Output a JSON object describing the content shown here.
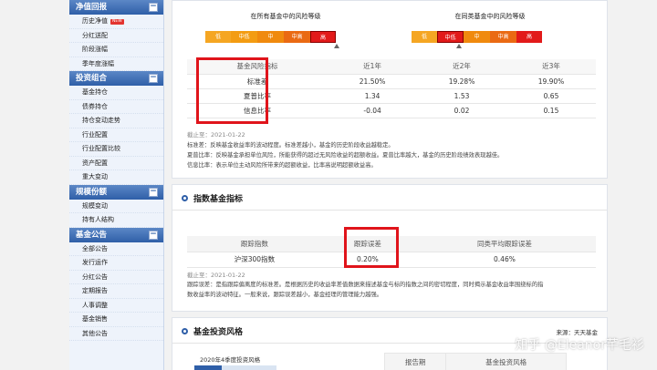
{
  "sidebar": {
    "sections": [
      {
        "title": "净值回报",
        "items": [
          {
            "label": "历史净值",
            "badge": "NEW"
          },
          {
            "label": "分红送配"
          },
          {
            "label": "阶段涨幅"
          },
          {
            "label": "季年度涨幅"
          }
        ]
      },
      {
        "title": "投资组合",
        "items": [
          {
            "label": "基金持仓"
          },
          {
            "label": "债券持仓"
          },
          {
            "label": "持仓变动走势"
          },
          {
            "label": "行业配置"
          },
          {
            "label": "行业配置比较"
          },
          {
            "label": "资产配置"
          },
          {
            "label": "重大变动"
          }
        ]
      },
      {
        "title": "规模份额",
        "items": [
          {
            "label": "规模变动"
          },
          {
            "label": "持有人结构"
          }
        ]
      },
      {
        "title": "基金公告",
        "items": [
          {
            "label": "全部公告"
          },
          {
            "label": "发行运作"
          },
          {
            "label": "分红公告"
          },
          {
            "label": "定期报告"
          },
          {
            "label": "人事调整"
          },
          {
            "label": "基金销售"
          },
          {
            "label": "其他公告"
          }
        ]
      }
    ]
  },
  "risk_level": {
    "all_funds_title": "在所有基金中的风险等级",
    "same_type_title": "在同类基金中的风险等级",
    "all_funds_levels": [
      "低",
      "中低",
      "中",
      "中高",
      "高"
    ],
    "all_funds_active": 4,
    "same_type_levels": [
      "低",
      "中低",
      "中",
      "中高",
      "高"
    ],
    "same_type_active": 1,
    "level_colors": [
      "#f5a623",
      "#f39c12",
      "#f08a0e",
      "#ea6a13",
      "#e21a1a"
    ]
  },
  "risk_table": {
    "headers": [
      "基金风险指标",
      "近1年",
      "近2年",
      "近3年"
    ],
    "rows": [
      [
        "标准差",
        "21.50%",
        "19.28%",
        "19.90%"
      ],
      [
        "夏普比率",
        "1.34",
        "1.53",
        "0.65"
      ],
      [
        "信息比率",
        "-0.04",
        "0.02",
        "0.15"
      ]
    ],
    "deadline": "截止至：2021-01-22",
    "notes": [
      "标准差：反映基金收益率的波动程度。标准差越小，基金的历史阶段收益越稳定。",
      "夏普比率：反映基金承担单位风险，所能获得的超过无风险收益的超额收益。夏普比率越大，基金的历史阶段绩效表现越佳。",
      "信息比率：表示单位主动风险所带来的超额收益，比率高说明超额收益高。"
    ]
  },
  "index_panel": {
    "title": "指数基金指标",
    "headers": [
      "跟踪指数",
      "跟踪误差",
      "同类平均跟踪误差"
    ],
    "row": [
      "沪深300指数",
      "0.20%",
      "0.46%"
    ],
    "deadline": "截止至：2021-01-22",
    "notes": [
      "跟踪误差：是指跟踪偏离度的标准差。是根据历史的收益率差值数据来描述基金与标的指数之间的密切程度，同时揭示基金收益率围绕标的指",
      "数收益率的波动特征。一般来说，跟踪误差越小，基金经理的管理能力越强。"
    ]
  },
  "style_panel": {
    "title": "基金投资风格",
    "source": "来源：天天基金",
    "caption": "2020年4季度投资风格",
    "report_headers": [
      "报告期",
      "基金投资风格"
    ]
  },
  "watermark": "知乎 @Eleanor芊毛衫"
}
